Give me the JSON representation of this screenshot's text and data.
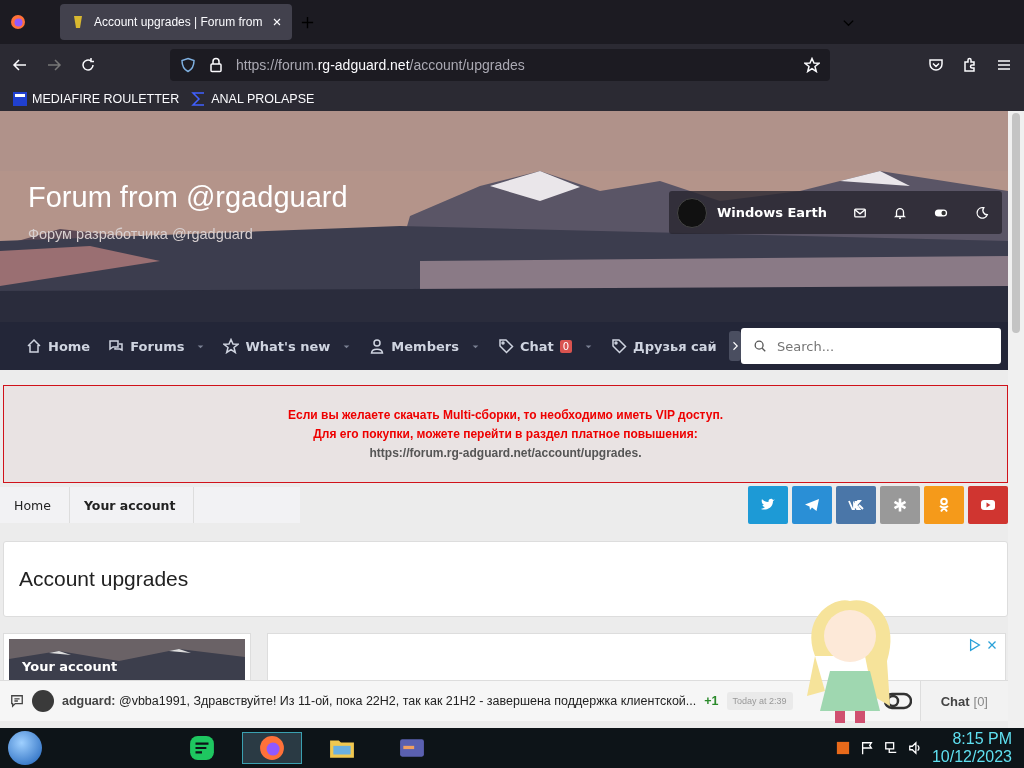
{
  "browser": {
    "tabs": [
      {
        "title": "Account upgrades | Forum from",
        "selected": true
      }
    ],
    "url": {
      "scheme": "https://forum.",
      "domain": "rg-adguard.net",
      "path": "/account/upgrades"
    },
    "bookmarks": [
      {
        "label": "MEDIAFIRE ROULETTER",
        "kind": "mf"
      },
      {
        "label": "ANAL PROLAPSE",
        "kind": "sigma"
      }
    ]
  },
  "header": {
    "title": "Forum from @rgadguard",
    "subtitle": "Форум разработчика @rgadguard",
    "user": {
      "name": "Windows Earth"
    }
  },
  "nav": {
    "items": [
      {
        "label": "Home",
        "kind": "home",
        "has_menu": false
      },
      {
        "label": "Forums",
        "kind": "chat",
        "has_menu": true
      },
      {
        "label": "What's new",
        "kind": "star",
        "has_menu": true
      },
      {
        "label": "Members",
        "kind": "user",
        "has_menu": true
      },
      {
        "label": "Chat",
        "kind": "tag",
        "has_menu": true,
        "badge": "0"
      },
      {
        "label": "Друзья сай",
        "kind": "tag",
        "has_menu": false
      }
    ],
    "search": {
      "placeholder": "Search..."
    }
  },
  "notice": {
    "lines": [
      "Если вы желаете скачать Multi-сборки, то необходимо иметь VIP доступ.",
      "Для его покупки, можете перейти в раздел платное повышения:"
    ],
    "link": "https://forum.rg-adguard.net/account/upgrades",
    "after": "."
  },
  "breadcrumb": [
    {
      "label": "Home",
      "selected": false
    },
    {
      "label": "Your account",
      "selected": true
    }
  ],
  "social": [
    {
      "kind": "twitter",
      "color": "#1d9ad6"
    },
    {
      "kind": "telegram",
      "color": "#2a8fd6"
    },
    {
      "kind": "vk",
      "color": "#4a76a8"
    },
    {
      "kind": "asterisk",
      "color": "#999999"
    },
    {
      "kind": "ok",
      "color": "#f59a1a"
    },
    {
      "kind": "youtube",
      "color": "#d03530"
    }
  ],
  "page_title": "Account upgrades",
  "sidebar": {
    "heading": "Your account"
  },
  "chat_bar": {
    "author": "adguard:",
    "message": "@vbba1991, Здравствуйте! Из 11-ой, пока 22H2, так как 21H2 - завершена поддержка клиентской...",
    "plus": "+1",
    "time": "Today at 2:39",
    "label": "Chat",
    "count": "[0]"
  },
  "taskbar": {
    "time": "8:15 PM",
    "date": "10/12/2023"
  }
}
